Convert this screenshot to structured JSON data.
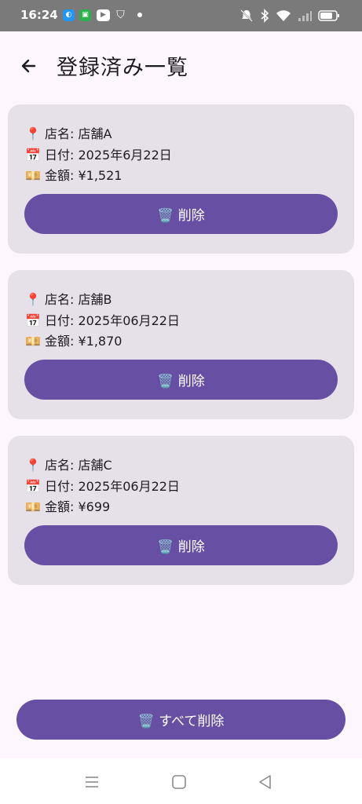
{
  "status_bar": {
    "time": "16:24",
    "icons": [
      "app-icon-blue",
      "app-icon-green",
      "youtube-icon",
      "shield-icon",
      "notification-dot",
      "mute-icon",
      "bluetooth-icon",
      "wifi-icon",
      "signal-icon",
      "battery-icon"
    ]
  },
  "header": {
    "title": "登録済み一覧",
    "back_icon": "arrow-left-icon"
  },
  "records": [
    {
      "store": "📍 店名: 店舗A",
      "date": "📅 日付: 2025年6月22日",
      "amount": "💴 金額: ¥1,521",
      "delete_label": "🗑️ 削除"
    },
    {
      "store": "📍 店名: 店舗B",
      "date": "📅 日付: 2025年06月22日",
      "amount": "💴 金額: ¥1,870",
      "delete_label": "🗑️ 削除"
    },
    {
      "store": "📍 店名: 店舗C",
      "date": "📅 日付: 2025年06月22日",
      "amount": "💴 金額: ¥699",
      "delete_label": "🗑️ 削除"
    }
  ],
  "delete_all_label": "🗑️ すべて削除",
  "colors": {
    "primary": "#6750a4",
    "card_background": "#e6e0e8",
    "page_background": "#fdf7fd"
  },
  "nav_bar": {
    "icons": [
      "recents-icon",
      "home-icon",
      "back-triangle-icon"
    ]
  }
}
